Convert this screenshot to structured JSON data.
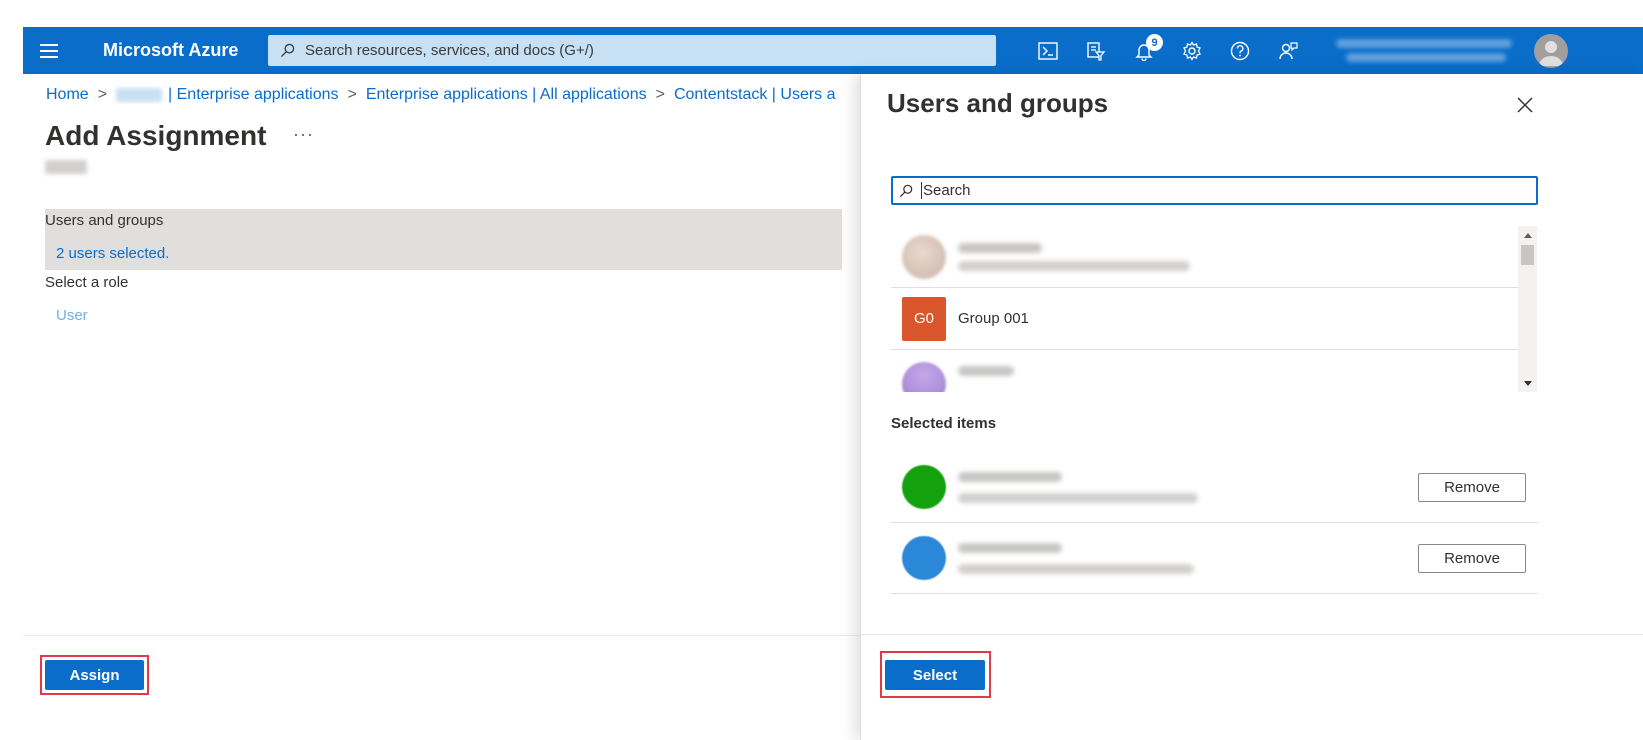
{
  "topbar": {
    "brand": "Microsoft Azure",
    "search_placeholder": "Search resources, services, and docs (G+/)",
    "notification_count": "9",
    "icons": [
      "cloud-shell-icon",
      "directory-filter-icon",
      "notifications-icon",
      "settings-icon",
      "help-icon",
      "feedback-icon"
    ]
  },
  "breadcrumb": {
    "home": "Home",
    "tenant_suffix": "| Enterprise applications",
    "all_apps": "Enterprise applications | All applications",
    "app": "Contentstack | Users a"
  },
  "page": {
    "title": "Add Assignment",
    "more": "···"
  },
  "assignment": {
    "users_groups_label": "Users and groups",
    "users_selected": "2 users selected.",
    "role_label": "Select a role",
    "role_value": "User",
    "assign_button": "Assign"
  },
  "panel": {
    "title": "Users and groups",
    "search_placeholder": "Search",
    "results": [
      {
        "type": "user"
      },
      {
        "type": "group",
        "initials": "G0",
        "name": "Group 001"
      },
      {
        "type": "user"
      }
    ],
    "selected_label": "Selected items",
    "selected": [
      {
        "remove_label": "Remove"
      },
      {
        "remove_label": "Remove"
      }
    ],
    "select_button": "Select"
  },
  "colors": {
    "accent": "#0a6dc9",
    "group_badge": "#d9552b",
    "highlight": "#e0394a"
  }
}
